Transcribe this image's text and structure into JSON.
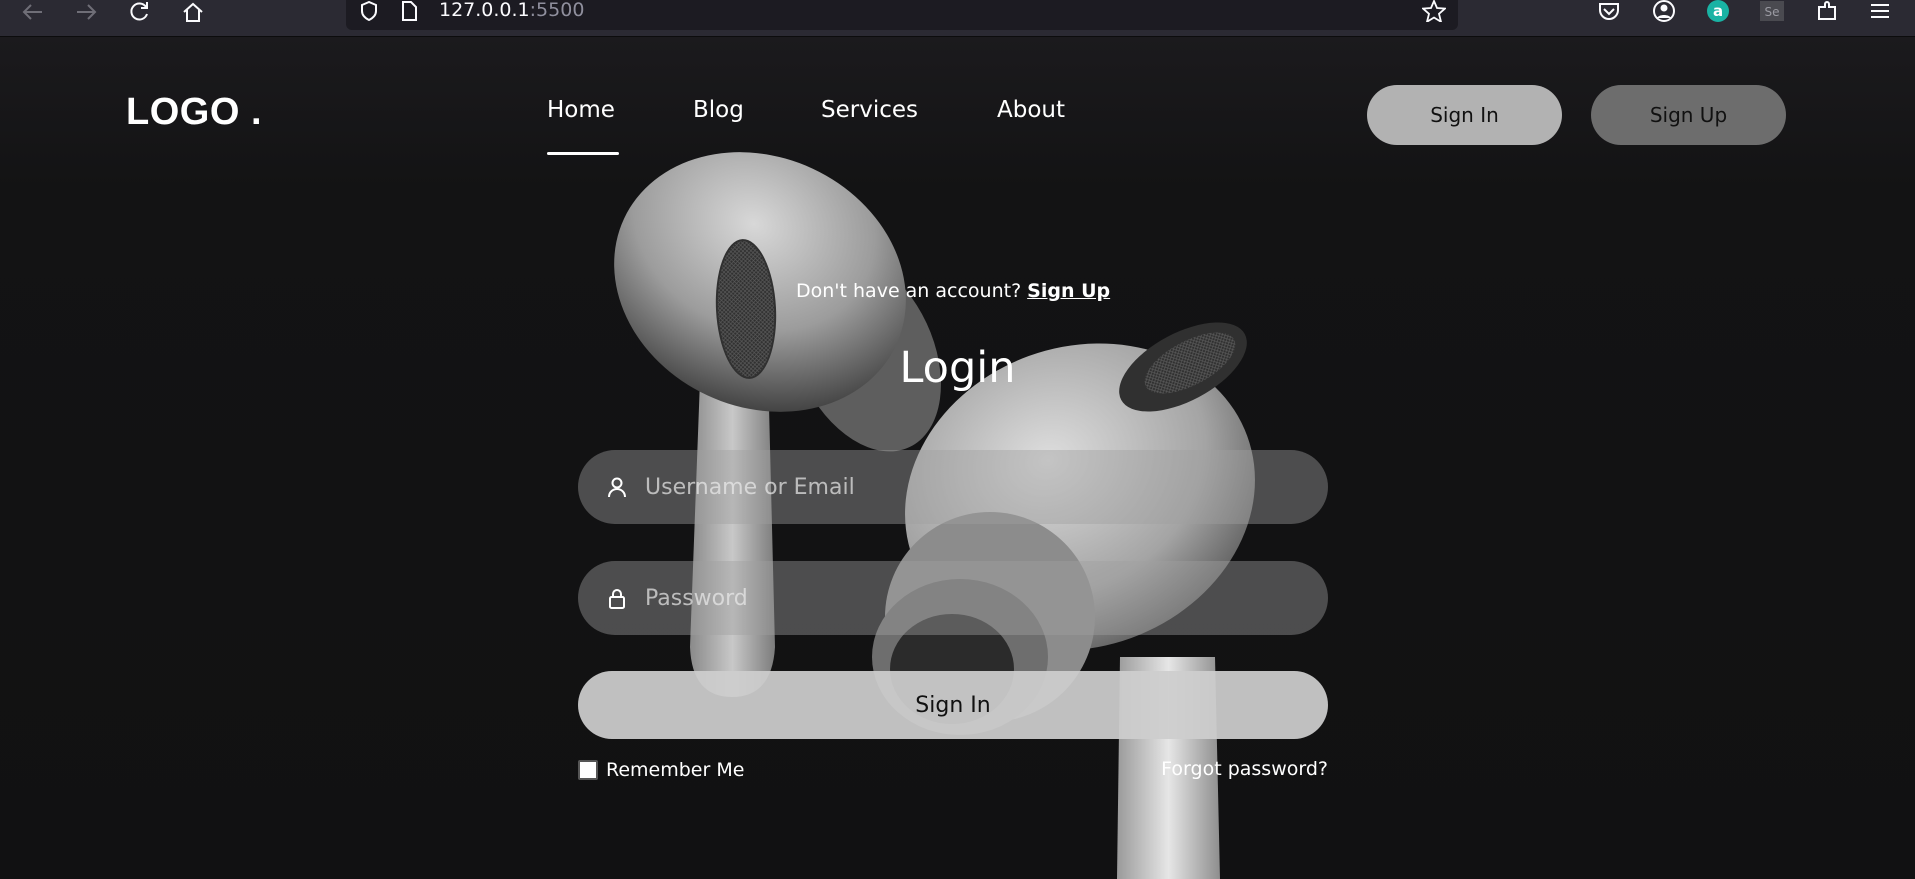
{
  "browser": {
    "url_host": "127.0.0.1",
    "url_port": ":5500"
  },
  "header": {
    "logo": "LOGO .",
    "nav": [
      {
        "label": "Home",
        "active": true
      },
      {
        "label": "Blog"
      },
      {
        "label": "Services"
      },
      {
        "label": "About"
      }
    ],
    "signin_label": "Sign In",
    "signup_label": "Sign Up"
  },
  "form": {
    "prompt": "Don't have an account?",
    "prompt_link": "Sign Up",
    "title": "Login",
    "username_placeholder": "Username or Email",
    "password_placeholder": "Password",
    "submit_label": "Sign In",
    "remember_label": "Remember Me",
    "forgot_label": "Forgot password?"
  },
  "colors": {
    "background": "#111112",
    "signin_pill": "#b2b2b2",
    "signup_pill": "#6d6d6d"
  },
  "icons": [
    "back-arrow-icon",
    "forward-arrow-icon",
    "reload-icon",
    "home-icon",
    "shield-icon",
    "page-icon",
    "star-icon",
    "pocket-icon",
    "account-icon",
    "extension-a-icon",
    "extension-se-icon",
    "extensions-icon",
    "menu-icon",
    "user-icon",
    "lock-icon"
  ]
}
